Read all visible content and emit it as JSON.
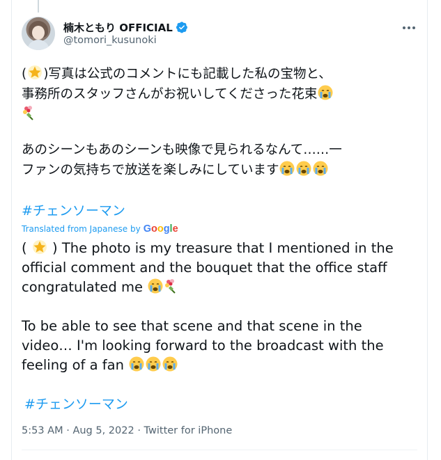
{
  "user": {
    "display_name": "楠木ともり OFFICIAL",
    "handle": "@tomori_kusunoki"
  },
  "tweet": {
    "jp_line1": ")写真は公式のコメントにも記載した私の宝物と、",
    "jp_line1_open": "(",
    "jp_line2": "事務所のスタッフさんがお祝いしてくださった花束",
    "jp_para2_line1": "あのシーンもあのシーンも映像で見られるなんて……一",
    "jp_para2_line2": "ファンの気持ちで放送を楽しみにしています",
    "hashtag": "#チェンソーマン"
  },
  "translation": {
    "label": "Translated from Japanese by",
    "provider": "Google",
    "line1_open": "(",
    "line1_rest": " ) The photo is my treasure that I mentioned in the",
    "line2": "official comment and the bouquet that the office staff",
    "line3": "congratulated me",
    "para2_line1": " To be able to see that scene and that scene in the",
    "para2_line2": "video… I'm looking forward to the broadcast with the",
    "para2_line3": "feeling of a fan",
    "hashtag": "#チェンソーマン"
  },
  "meta": {
    "time": "5:53 AM",
    "sep1": " · ",
    "date": "Aug 5, 2022",
    "sep2": " · ",
    "source": "Twitter for iPhone"
  },
  "colors": {
    "link": "#1d9bf0",
    "secondary_text": "#536471",
    "verified": "#1d9bf0"
  },
  "icons": [
    "verified-badge-icon",
    "more-options-icon",
    "glowing-star-emoji",
    "crying-face-emoji",
    "bouquet-emoji"
  ]
}
